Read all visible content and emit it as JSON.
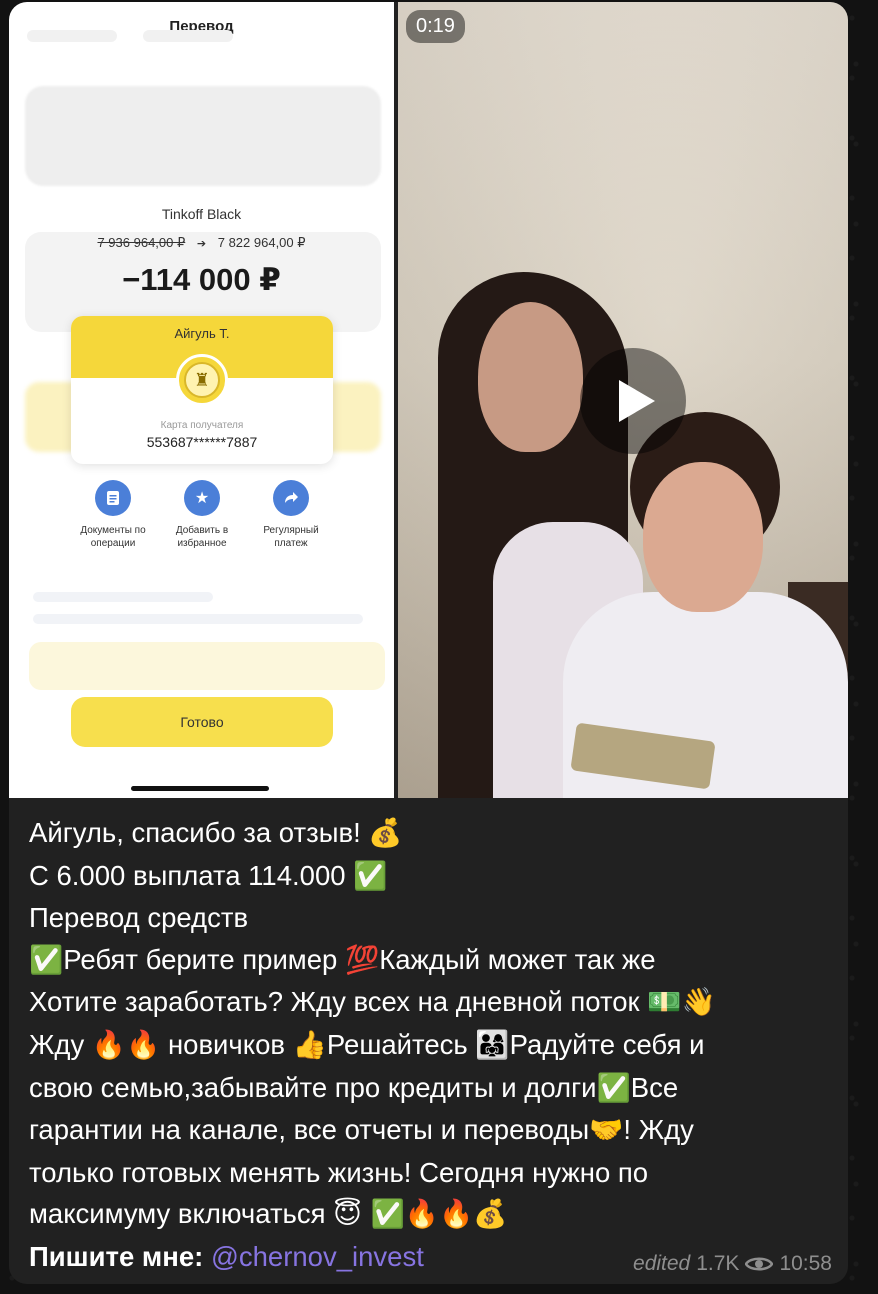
{
  "media": {
    "duration": "0:19",
    "screenshot": {
      "title": "Перевод",
      "card_name": "Tinkoff Black",
      "balance_old": "7 936 964,00 ₽",
      "balance_new": "7 822 964,00 ₽",
      "amount": "−114 000 ₽",
      "recipient_name": "Айгуль Т.",
      "recipient_label": "Карта получателя",
      "recipient_number": "553687******7887",
      "actions": [
        {
          "label": "Документы по операции",
          "icon": "document-icon"
        },
        {
          "label": "Добавить в избранное",
          "icon": "star-icon"
        },
        {
          "label": "Регулярный платеж",
          "icon": "repeat-icon"
        }
      ],
      "done_label": "Готово"
    }
  },
  "caption": {
    "l1_text": "Айгуль, спасибо за отзыв! ",
    "l1_e1": "💰",
    "l2_text": "С 6.000 выплата 114.000 ",
    "l2_e1": "✅",
    "l3_text": "Перевод средств",
    "l4_e1": "✅",
    "l4_t1": "Ребят берите пример ",
    "l4_e2": "💯",
    "l4_t2": "Каждый может так же",
    "l5_text": "Хотите заработать? Жду всех на дневной поток ",
    "l5_e1": "💵👋",
    "l6_t1": "Жду ",
    "l6_e1": "🔥🔥",
    "l6_t2": " новичков ",
    "l6_e2": "👍",
    "l6_t3": "Решайтесь ",
    "l6_e3": "👨‍👩‍👧",
    "l6_t4": "Радуйте себя и",
    "l7_t1": "свою семью,забывайте про кредиты и долги",
    "l7_e1": "✅",
    "l7_t2": "Все",
    "l8_t1": "гарантии на канале, все отчеты и переводы",
    "l8_e1": "🤝",
    "l8_t2": "! Жду",
    "l9_text": "только готовых менять жизнь!  Сегодня нужно по",
    "l10_t1": "максимуму включаться ",
    "l10_e1": "😇 ✅🔥🔥💰",
    "contact_label": "Пишите мне:",
    "contact_handle": "@chernov_invest"
  },
  "meta": {
    "edited": "edited",
    "views": "1.7K",
    "time": "10:58"
  },
  "colors": {
    "bubble": "#212121",
    "link": "#8774e1",
    "meta": "#8e8e8e",
    "tinkoff_yellow": "#f7df4d",
    "action_blue": "#4b7fd8"
  }
}
